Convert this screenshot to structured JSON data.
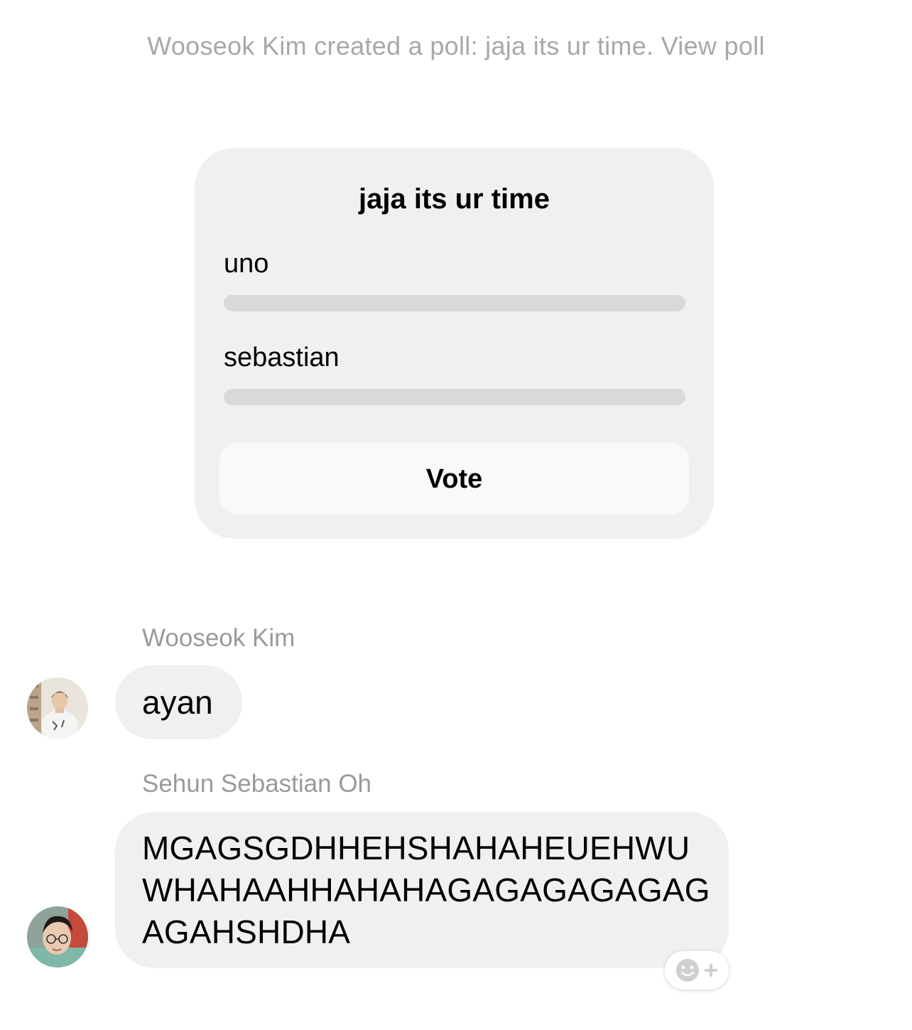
{
  "system_message": {
    "text": "Wooseok Kim created a poll: jaja its ur time. View poll"
  },
  "poll": {
    "title": "jaja its ur time",
    "options": [
      {
        "label": "uno",
        "vote_fraction": 0
      },
      {
        "label": "sebastian",
        "vote_fraction": 0
      }
    ],
    "vote_label": "Vote"
  },
  "messages": [
    {
      "sender": "Wooseok Kim",
      "text": "ayan",
      "avatar_icon": "profile-photo"
    },
    {
      "sender": "Sehun Sebastian Oh",
      "text": "MGAGSGDHHEHSHAHAHEUEHWUWHAHAAHHAHAHAGAGAGAGAGAGAGAHSHDHA",
      "avatar_icon": "profile-photo"
    }
  ],
  "reaction_button": {
    "icon": "add-reaction-icon"
  },
  "colors": {
    "background": "#ffffff",
    "bubble": "#f0f0f0",
    "muted_text": "#a8a8a8",
    "poll_bar": "#d9d9dc",
    "vote_button": "#f9f9f9"
  }
}
